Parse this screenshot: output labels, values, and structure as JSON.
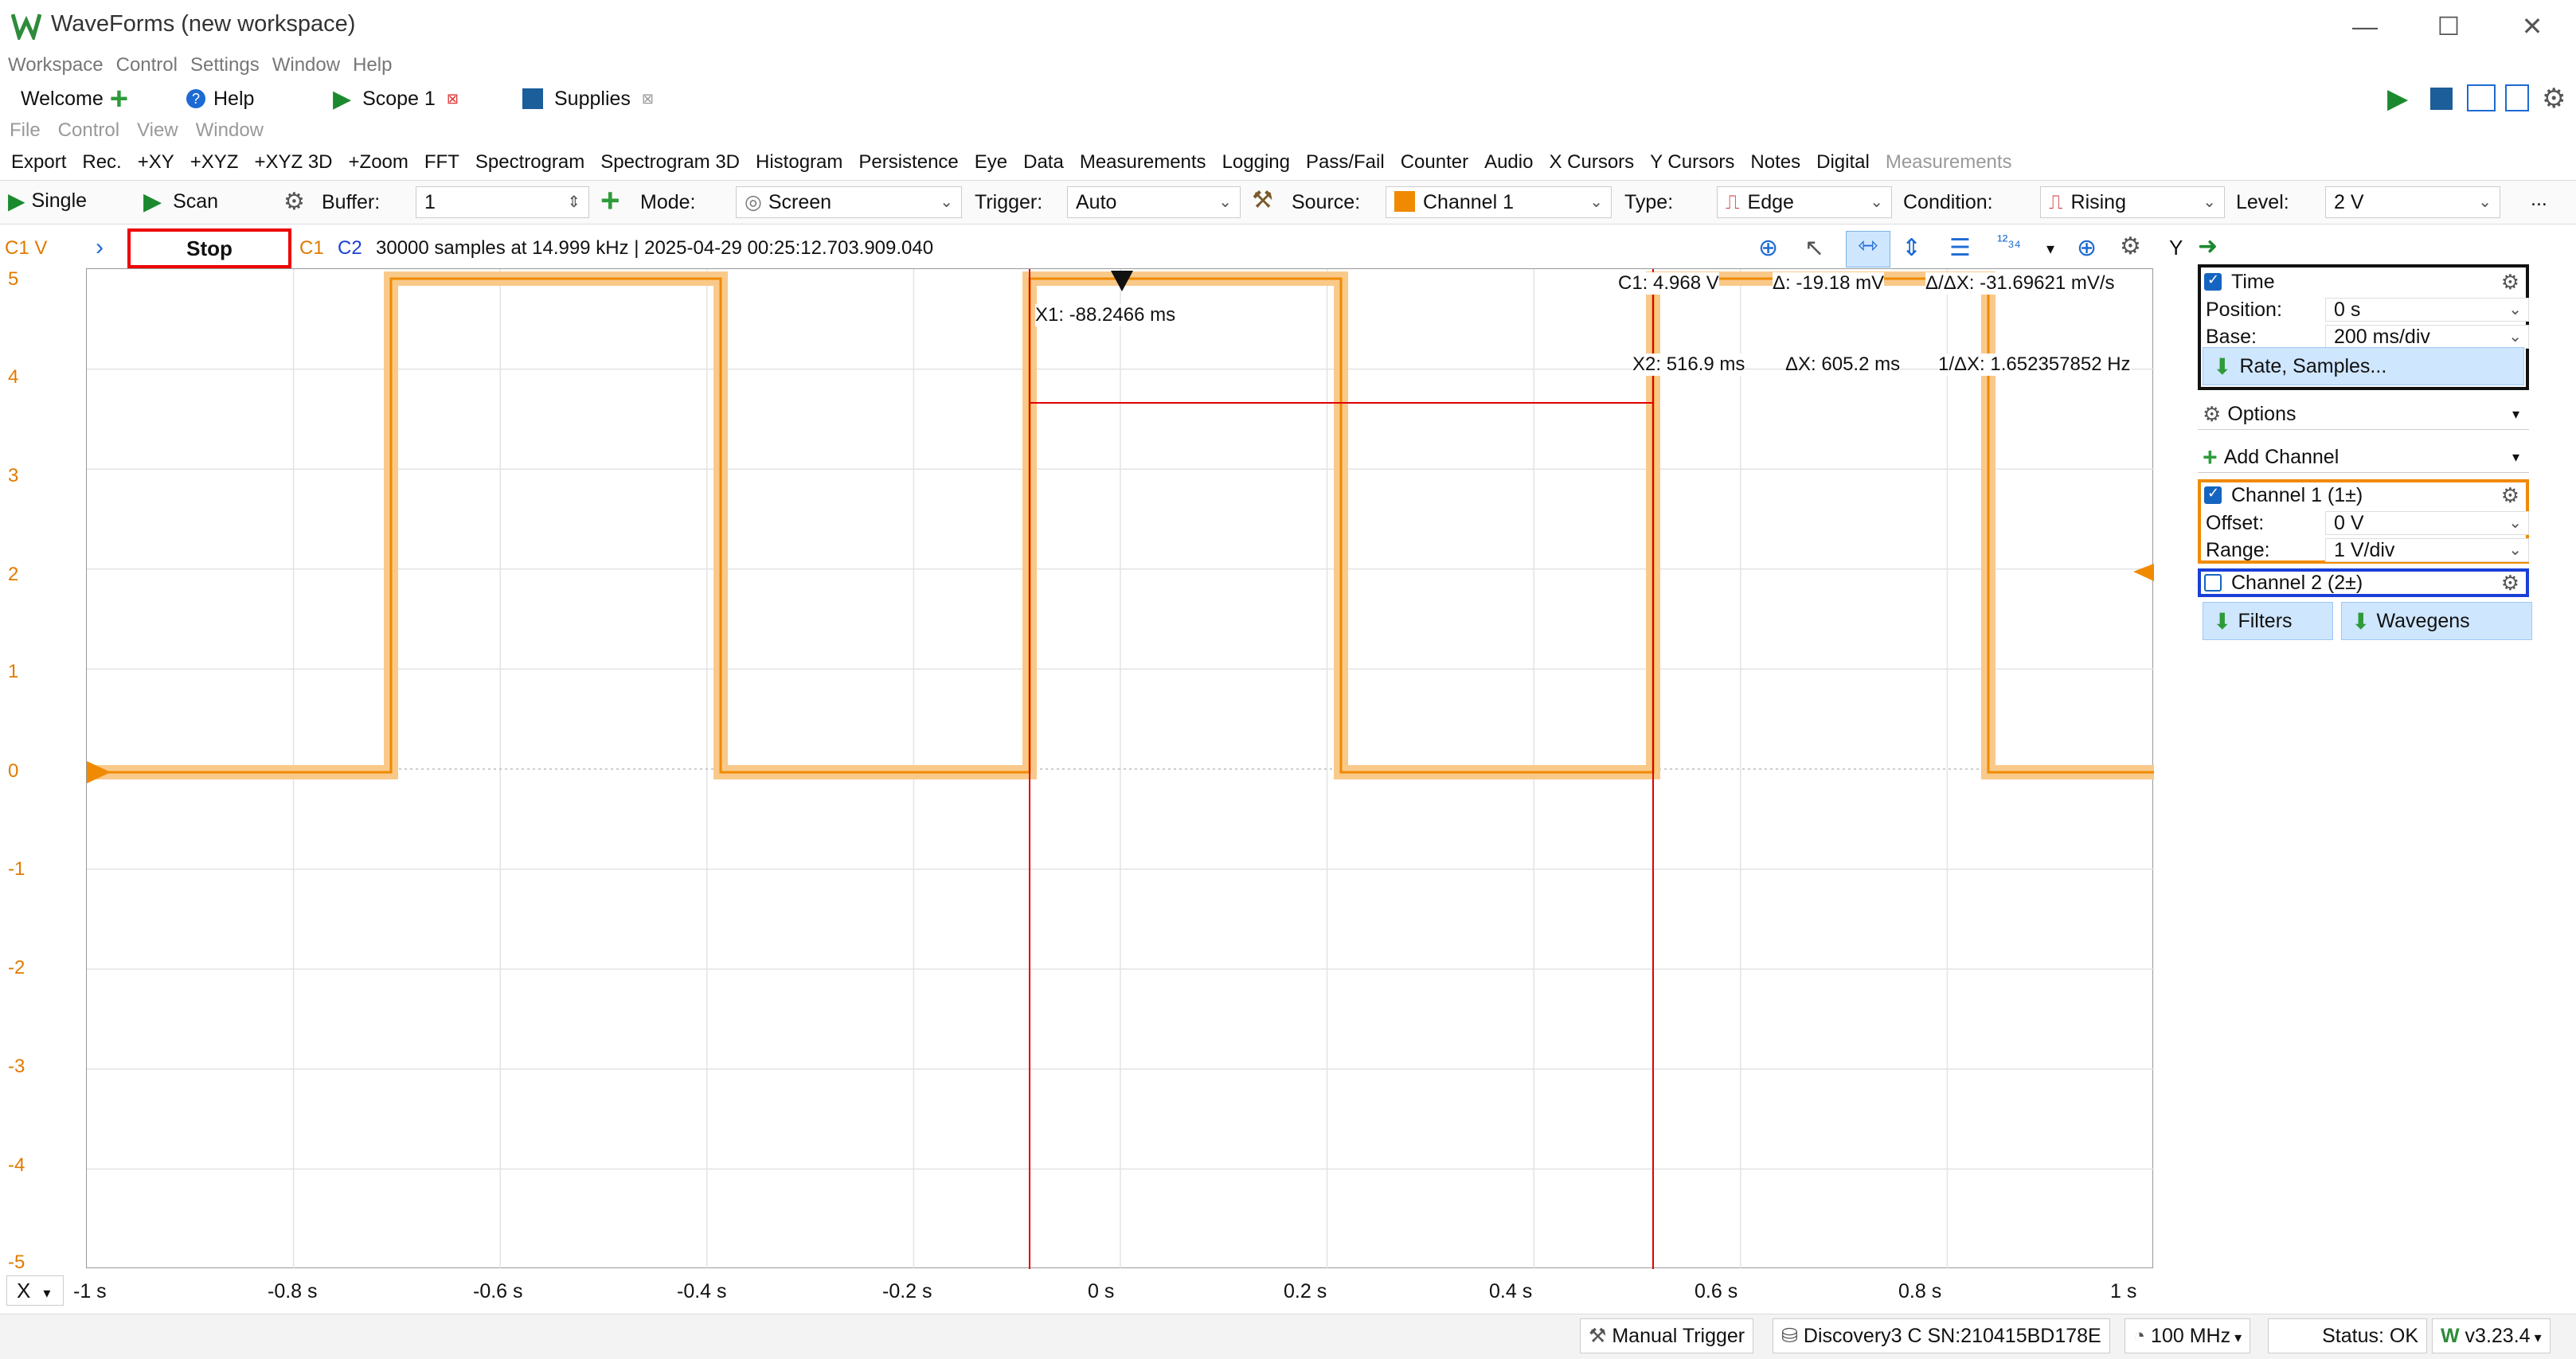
{
  "window": {
    "title": "WaveForms (new workspace)"
  },
  "menu": [
    "Workspace",
    "Control",
    "Settings",
    "Window",
    "Help"
  ],
  "tabs": [
    {
      "label": "Welcome"
    },
    {
      "label": "Help"
    },
    {
      "label": "Scope 1"
    },
    {
      "label": "Supplies"
    }
  ],
  "submenu": [
    "File",
    "Control",
    "View",
    "Window"
  ],
  "toolbar": [
    "Export",
    "Rec.",
    "+XY",
    "+XYZ",
    "+XYZ 3D",
    "+Zoom",
    "FFT",
    "Spectrogram",
    "Spectrogram 3D",
    "Histogram",
    "Persistence",
    "Eye",
    "Data",
    "Measurements",
    "Logging",
    "Pass/Fail",
    "Counter",
    "Audio",
    "X Cursors",
    "Y Cursors",
    "Notes",
    "Digital"
  ],
  "toolbar_dim": "Measurements",
  "controls": {
    "single": "Single",
    "scan": "Scan",
    "buffer_label": "Buffer:",
    "buffer_value": "1",
    "mode_label": "Mode:",
    "mode_value": "Screen",
    "trigger_label": "Trigger:",
    "trigger_value": "Auto",
    "source_label": "Source:",
    "source_value": "Channel 1",
    "type_label": "Type:",
    "type_value": "Edge",
    "condition_label": "Condition:",
    "condition_value": "Rising",
    "level_label": "Level:",
    "level_value": "2 V",
    "more": "..."
  },
  "status": {
    "c1v": "C1 V",
    "stop": "Stop",
    "c1": "C1",
    "c2": "C2",
    "info": "30000 samples at 14.999 kHz  | 2025-04-29 00:25:12.703.909.040",
    "y": "Y"
  },
  "cursors": {
    "x1": "X1: -88.2466 ms",
    "c1": "C1: 4.968 V",
    "dy": "Δ: -19.18 mV",
    "dydx": "Δ/ΔX: -31.69621 mV/s",
    "x2": "X2: 516.9 ms",
    "dx": "ΔX: 605.2 ms",
    "inv": "1/ΔX: 1.652357852 Hz"
  },
  "yaxis": [
    "5",
    "4",
    "3",
    "2",
    "1",
    "0",
    "-1",
    "-2",
    "-3",
    "-4",
    "-5"
  ],
  "xaxis": [
    "-1 s",
    "-0.8 s",
    "-0.6 s",
    "-0.4 s",
    "-0.2 s",
    "0 s",
    "0.2 s",
    "0.4 s",
    "0.6 s",
    "0.8 s",
    "1 s"
  ],
  "x_label": "X",
  "panel": {
    "time": "Time",
    "position_k": "Position:",
    "position_v": "0 s",
    "base_k": "Base:",
    "base_v": "200 ms/div",
    "rate": "Rate, Samples...",
    "options": "Options",
    "add_channel": "Add Channel",
    "ch1": "Channel 1 (1±)",
    "offset_k": "Offset:",
    "offset_v": "0 V",
    "range_k": "Range:",
    "range_v": "1 V/div",
    "ch2": "Channel 2 (2±)",
    "filters": "Filters",
    "wavegens": "Wavegens"
  },
  "bottom": {
    "manual": "Manual Trigger",
    "device": "Discovery3 C SN:210415BD178E",
    "freq": "100 MHz",
    "status": "Status: OK",
    "version": "v3.23.4"
  },
  "colors": {
    "ch1": "#f08a00",
    "ch2": "#1a3fd6",
    "cursor": "#e00000",
    "accent_green": "#1b8a2f"
  }
}
